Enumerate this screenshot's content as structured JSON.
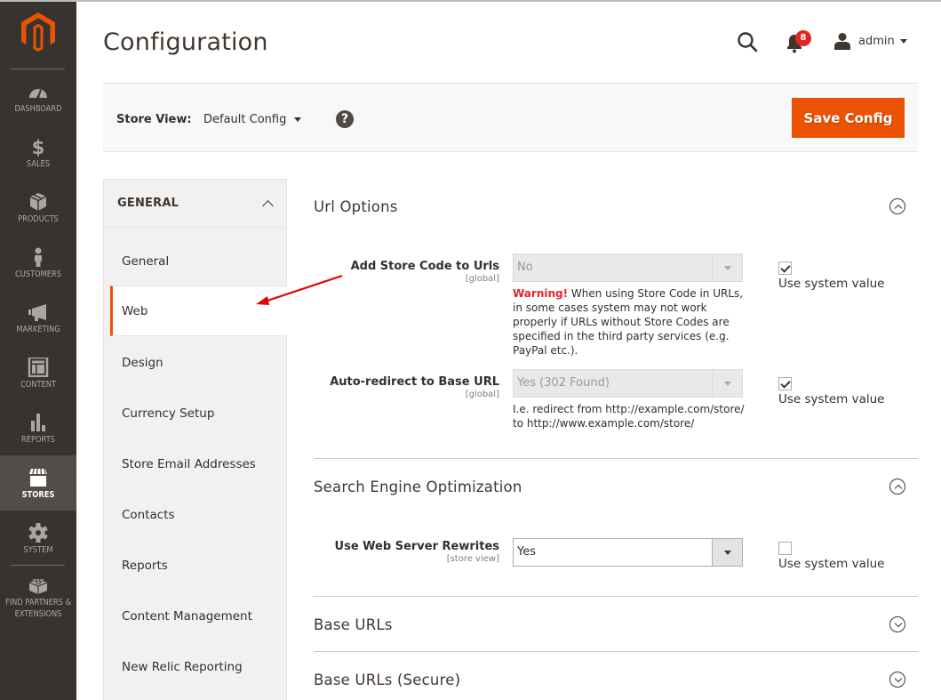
{
  "admin_nav": {
    "items": [
      {
        "label": "DASHBOARD",
        "icon": "dashboard-icon"
      },
      {
        "label": "SALES",
        "icon": "dollar-icon"
      },
      {
        "label": "PRODUCTS",
        "icon": "box-icon"
      },
      {
        "label": "CUSTOMERS",
        "icon": "person-icon"
      },
      {
        "label": "MARKETING",
        "icon": "megaphone-icon"
      },
      {
        "label": "CONTENT",
        "icon": "layout-icon"
      },
      {
        "label": "REPORTS",
        "icon": "bar-chart-icon"
      },
      {
        "label": "STORES",
        "icon": "storefront-icon",
        "active": true
      },
      {
        "label": "SYSTEM",
        "icon": "gear-icon"
      },
      {
        "label": "FIND PARTNERS & EXTENSIONS",
        "icon": "lego-brick-icon"
      }
    ]
  },
  "header": {
    "title": "Configuration",
    "notifications_count": "8",
    "user_name": "admin"
  },
  "store_bar": {
    "label": "Store View:",
    "selected": "Default Config",
    "help": "?",
    "save_label": "Save Config"
  },
  "colors": {
    "accent": "#eb5202",
    "nav_bg": "#373330",
    "warning": "#e22626"
  },
  "tabs": {
    "group": "GENERAL",
    "items": [
      {
        "label": "General"
      },
      {
        "label": "Web",
        "active": true
      },
      {
        "label": "Design"
      },
      {
        "label": "Currency Setup"
      },
      {
        "label": "Store Email Addresses"
      },
      {
        "label": "Contacts"
      },
      {
        "label": "Reports"
      },
      {
        "label": "Content Management"
      },
      {
        "label": "New Relic Reporting"
      }
    ]
  },
  "sections": {
    "url_options": {
      "title": "Url Options",
      "expanded": true,
      "fields": [
        {
          "label": "Add Store Code to Urls",
          "scope": "[global]",
          "value": "No",
          "disabled": true,
          "note_warning": "Warning!",
          "note": " When using Store Code in URLs, in some cases system may not work properly if URLs without Store Codes are specified in the third party services (e.g. PayPal etc.).",
          "use_system_value": true,
          "system_label": "Use system value"
        },
        {
          "label": "Auto-redirect to Base URL",
          "scope": "[global]",
          "value": "Yes (302 Found)",
          "disabled": true,
          "note": "I.e. redirect from http://example.com/store/ to http://www.example.com/store/",
          "use_system_value": true,
          "system_label": "Use system value"
        }
      ]
    },
    "seo": {
      "title": "Search Engine Optimization",
      "expanded": true,
      "fields": [
        {
          "label": "Use Web Server Rewrites",
          "scope": "[store view]",
          "value": "Yes",
          "disabled": false,
          "use_system_value": false,
          "system_label": "Use system value"
        }
      ]
    },
    "base_urls": {
      "title": "Base URLs",
      "expanded": false
    },
    "base_urls_secure": {
      "title": "Base URLs (Secure)",
      "expanded": false
    }
  }
}
